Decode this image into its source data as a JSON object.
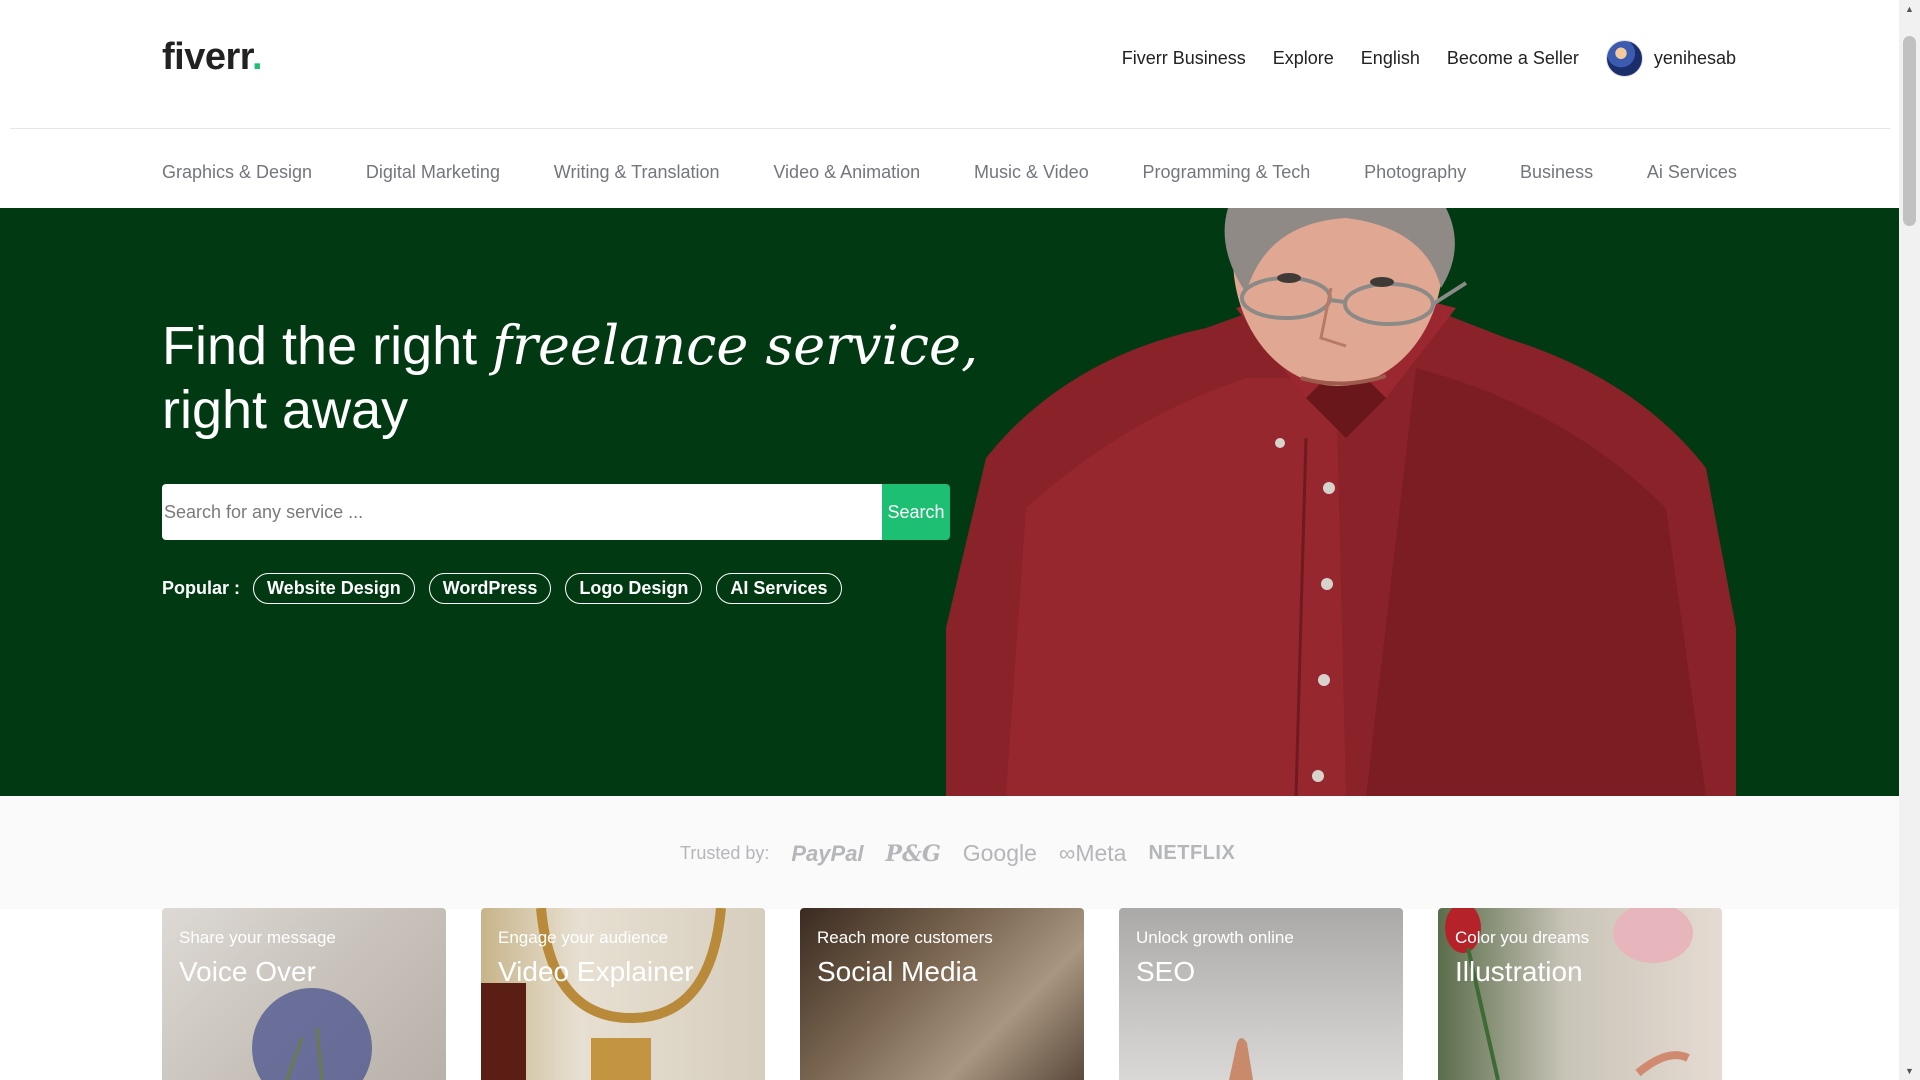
{
  "header": {
    "logo_text": "fiverr",
    "logo_dot": ".",
    "nav": [
      "Fiverr Business",
      "Explore",
      "English",
      "Become a Seller"
    ],
    "username": "yenihesab"
  },
  "categories": [
    "Graphics & Design",
    "Digital Marketing",
    "Writing & Translation",
    "Video & Animation",
    "Music & Video",
    "Programming & Tech",
    "Photography",
    "Business",
    "Ai Services"
  ],
  "hero": {
    "title_part1": "Find the right ",
    "title_italic": "freelance service,",
    "title_part2": "right away",
    "search_placeholder": "Search for any service ...",
    "search_button": "Search",
    "popular_label": "Popular :",
    "popular_tags": [
      "Website Design",
      "WordPress",
      "Logo Design",
      "AI Services"
    ],
    "background_color": "#003912",
    "accent_color": "#1dbf73"
  },
  "trusted": {
    "label": "Trusted by:",
    "brands": [
      "PayPal",
      "P&G",
      "Google",
      "∞Meta",
      "NETFLIX"
    ]
  },
  "cards": [
    {
      "subtitle": "Share your message",
      "title": "Voice Over"
    },
    {
      "subtitle": "Engage your audience",
      "title": "Video Explainer"
    },
    {
      "subtitle": "Reach more customers",
      "title": "Social Media"
    },
    {
      "subtitle": "Unlock growth online",
      "title": "SEO"
    },
    {
      "subtitle": "Color you dreams",
      "title": "Illustration"
    }
  ]
}
